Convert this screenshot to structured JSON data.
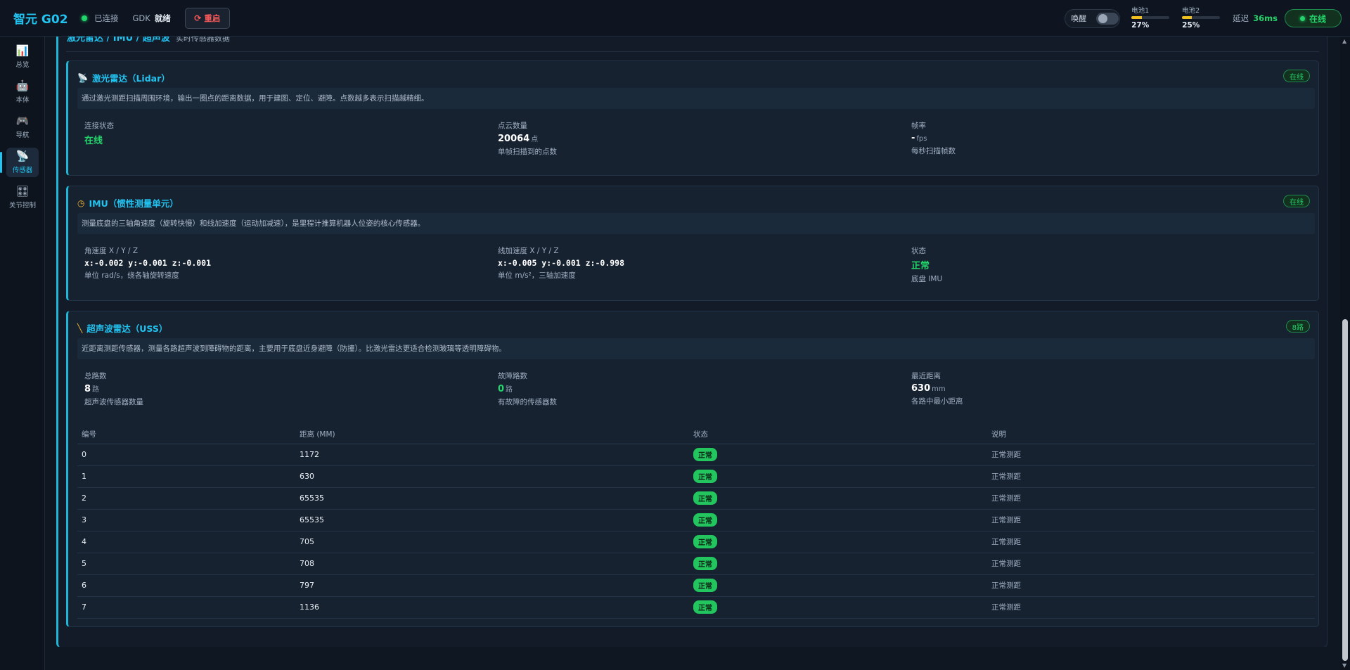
{
  "header": {
    "brand": "智元 G02",
    "connection": "已连接",
    "gdk_label": "GDK",
    "gdk_status": "就绪",
    "restart_label": "重启",
    "wake_label": "唤醒",
    "battery1": {
      "label": "电池1",
      "percent": "27%",
      "level": 0.27
    },
    "battery2": {
      "label": "电池2",
      "percent": "25%",
      "level": 0.25
    },
    "latency_label": "延迟",
    "latency_value": "36ms",
    "online_label": "在线"
  },
  "sidebar": {
    "items": [
      {
        "label": "总览",
        "icon": "chart-icon",
        "glyph": "📊"
      },
      {
        "label": "本体",
        "icon": "robot-icon",
        "glyph": "🤖"
      },
      {
        "label": "导航",
        "icon": "gamepad-icon",
        "glyph": "🎮"
      },
      {
        "label": "传感器",
        "icon": "satellite-dish-icon",
        "glyph": "📡"
      },
      {
        "label": "关节控制",
        "icon": "joint-icon",
        "glyph": "🎛"
      }
    ],
    "active_index": 3
  },
  "section": {
    "title": "激光雷达 / IMU / 超声波",
    "subtitle": "实时传感器数据"
  },
  "lidar": {
    "title": "激光雷达（Lidar）",
    "badge": "在线",
    "description": "通过激光测距扫描周围环境，输出一圈点的距离数据，用于建图、定位、避障。点数越多表示扫描越精细。",
    "metrics": [
      {
        "label": "连接状态",
        "value": "在线",
        "unit": "",
        "hint": ""
      },
      {
        "label": "点云数量",
        "value": "20064",
        "unit": "点",
        "hint": "单帧扫描到的点数"
      },
      {
        "label": "帧率",
        "value": "-",
        "unit": "fps",
        "hint": "每秒扫描帧数"
      }
    ]
  },
  "imu": {
    "title": "IMU（惯性测量单元）",
    "badge": "在线",
    "description": "测量底盘的三轴角速度（旋转快慢）和线加速度（运动加减速），是里程计推算机器人位姿的核心传感器。",
    "metrics": [
      {
        "label": "角速度 X / Y / Z",
        "value": "x:-0.002 y:-0.001 z:-0.001",
        "hint": "单位 rad/s，绕各轴旋转速度"
      },
      {
        "label": "线加速度 X / Y / Z",
        "value": "x:-0.005 y:-0.001 z:-0.998",
        "hint": "单位 m/s²，三轴加速度"
      },
      {
        "label": "状态",
        "value": "正常",
        "hint": "底盘 IMU"
      }
    ]
  },
  "uss": {
    "title": "超声波雷达（USS）",
    "badge": "8路",
    "description": "近距离测距传感器，测量各路超声波到障碍物的距离，主要用于底盘近身避障（防撞）。比激光雷达更适合检测玻璃等透明障碍物。",
    "metrics": [
      {
        "label": "总路数",
        "value": "8",
        "unit": "路",
        "hint": "超声波传感器数量"
      },
      {
        "label": "故障路数",
        "value": "0",
        "unit": "路",
        "hint": "有故障的传感器数"
      },
      {
        "label": "最近距离",
        "value": "630",
        "unit": "mm",
        "hint": "各路中最小距离"
      }
    ],
    "columns": [
      "编号",
      "距离 (MM)",
      "状态",
      "说明"
    ],
    "rows": [
      {
        "id": "0",
        "distance": "1172",
        "status": "正常",
        "note": "正常测距"
      },
      {
        "id": "1",
        "distance": "630",
        "status": "正常",
        "note": "正常测距"
      },
      {
        "id": "2",
        "distance": "65535",
        "status": "正常",
        "note": "正常测距"
      },
      {
        "id": "3",
        "distance": "65535",
        "status": "正常",
        "note": "正常测距"
      },
      {
        "id": "4",
        "distance": "705",
        "status": "正常",
        "note": "正常测距"
      },
      {
        "id": "5",
        "distance": "708",
        "status": "正常",
        "note": "正常测距"
      },
      {
        "id": "6",
        "distance": "797",
        "status": "正常",
        "note": "正常测距"
      },
      {
        "id": "7",
        "distance": "1136",
        "status": "正常",
        "note": "正常测距"
      }
    ]
  },
  "colors": {
    "accent": "#22c3f0",
    "ok_green": "#22d56a",
    "danger": "#ff5a5a",
    "battery": "#f0c020"
  }
}
